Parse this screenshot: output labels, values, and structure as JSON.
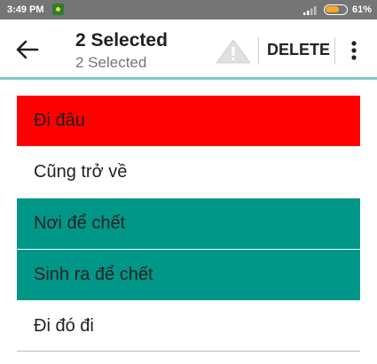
{
  "status_bar": {
    "time": "3:49 PM",
    "battery_percent": "61%",
    "battery_level": 0.61,
    "icons": [
      "notification-icon",
      "signal-icon",
      "battery-icon"
    ]
  },
  "app_bar": {
    "title": "2 Selected",
    "subtitle": "2 Selected",
    "delete_label": "DELETE",
    "icons": [
      "back-arrow-icon",
      "warning-icon",
      "more-vert-icon"
    ]
  },
  "list": {
    "items": [
      {
        "label": "Đi đâu",
        "highlight": "#ff0000"
      },
      {
        "label": "Cũng trở về",
        "highlight": null
      },
      {
        "label": "Nơi để chết",
        "highlight": "#009688"
      },
      {
        "label": "Sinh ra để chết",
        "highlight": "#009688"
      },
      {
        "label": "Đi đó đi",
        "highlight": null
      }
    ]
  },
  "colors": {
    "status_bar": "#757575",
    "accent": "#009688",
    "error": "#ff0000"
  }
}
